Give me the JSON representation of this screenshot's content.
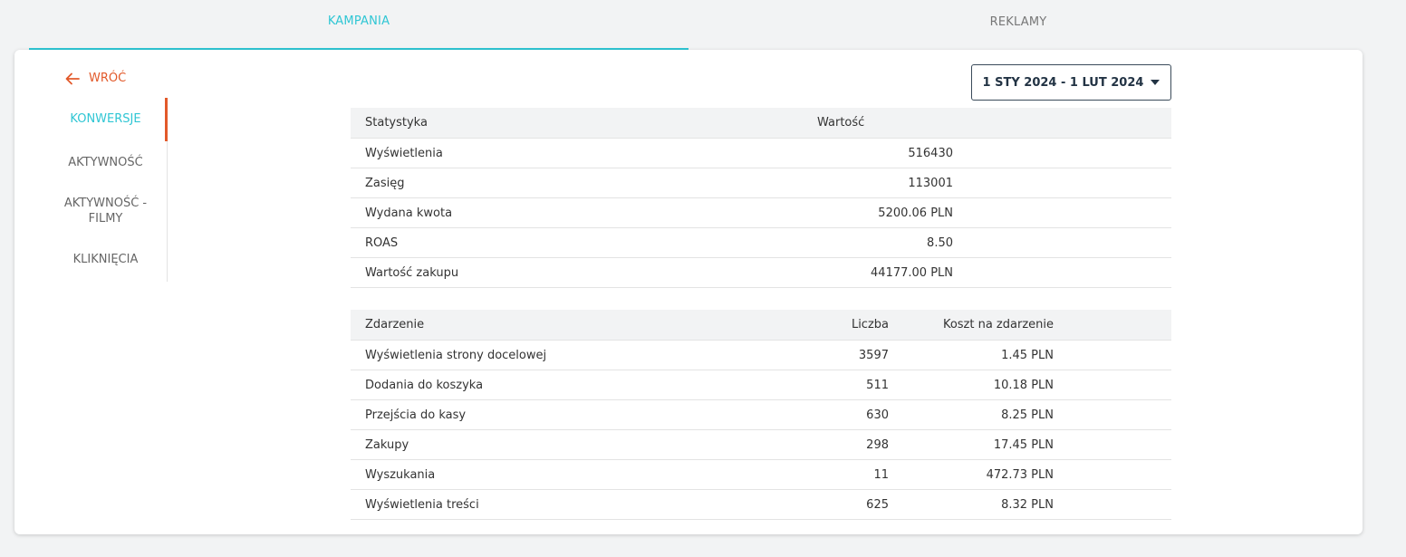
{
  "tabs": [
    {
      "label": "KAMPANIA",
      "active": true
    },
    {
      "label": "REKLAMY",
      "active": false
    }
  ],
  "back": {
    "label": "WRÓĆ"
  },
  "sidenav": {
    "items": [
      {
        "label": "KONWERSJE",
        "active": true
      },
      {
        "label": "AKTYWNOŚĆ",
        "active": false
      },
      {
        "label": "AKTYWNOŚĆ - FILMY",
        "active": false
      },
      {
        "label": "KLIKNIĘCIA",
        "active": false
      }
    ]
  },
  "date_range": {
    "label": "1 STY 2024 - 1 LUT 2024"
  },
  "stats_table": {
    "headers": {
      "name": "Statystyka",
      "value": "Wartość"
    },
    "rows": [
      {
        "name": "Wyświetlenia",
        "value": "516430"
      },
      {
        "name": "Zasięg",
        "value": "113001"
      },
      {
        "name": "Wydana kwota",
        "value": "5200.06 PLN"
      },
      {
        "name": "ROAS",
        "value": "8.50"
      },
      {
        "name": "Wartość zakupu",
        "value": "44177.00 PLN"
      }
    ]
  },
  "events_table": {
    "headers": {
      "name": "Zdarzenie",
      "count": "Liczba",
      "cost": "Koszt na zdarzenie"
    },
    "rows": [
      {
        "name": "Wyświetlenia strony docelowej",
        "count": "3597",
        "cost": "1.45 PLN"
      },
      {
        "name": "Dodania do koszyka",
        "count": "511",
        "cost": "10.18 PLN"
      },
      {
        "name": "Przejścia do kasy",
        "count": "630",
        "cost": "8.25 PLN"
      },
      {
        "name": "Zakupy",
        "count": "298",
        "cost": "17.45 PLN"
      },
      {
        "name": "Wyszukania",
        "count": "11",
        "cost": "472.73 PLN"
      },
      {
        "name": "Wyświetlenia treści",
        "count": "625",
        "cost": "8.32 PLN"
      }
    ]
  },
  "colors": {
    "accent": "#2fc6d4",
    "back": "#e2592a"
  }
}
